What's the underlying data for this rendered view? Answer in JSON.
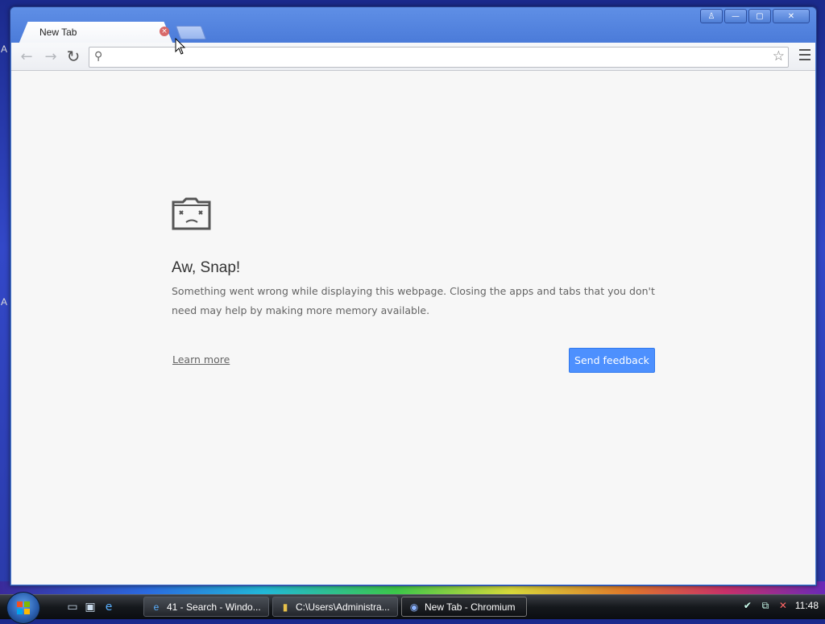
{
  "desktop": {
    "edge_letters": [
      "A",
      "A"
    ]
  },
  "window": {
    "controls": {
      "user": "♙",
      "minimize": "—",
      "maximize": "▢",
      "close": "✕"
    },
    "tab": {
      "title": "New Tab",
      "close": "×"
    },
    "toolbar": {
      "back": "←",
      "forward": "→",
      "reload": "↻",
      "omnibox_value": "",
      "search_icon": "⚲",
      "star_icon": "☆"
    }
  },
  "page": {
    "title": "Aw, Snap!",
    "message": "Something went wrong while displaying this webpage. Closing the apps and tabs that you don't need may help by making more memory available.",
    "learn_more": "Learn more",
    "send_feedback": "Send feedback"
  },
  "taskbar": {
    "quick_launch": [
      "show-desktop-icon",
      "switch-windows-icon",
      "internet-explorer-icon"
    ],
    "buttons": [
      {
        "label": "41 - Search - Windo...",
        "icon": "e"
      },
      {
        "label": "C:\\Users\\Administra...",
        "icon": "▮"
      },
      {
        "label": "New Tab - Chromium",
        "icon": "◉"
      }
    ],
    "clock": "11:48"
  }
}
